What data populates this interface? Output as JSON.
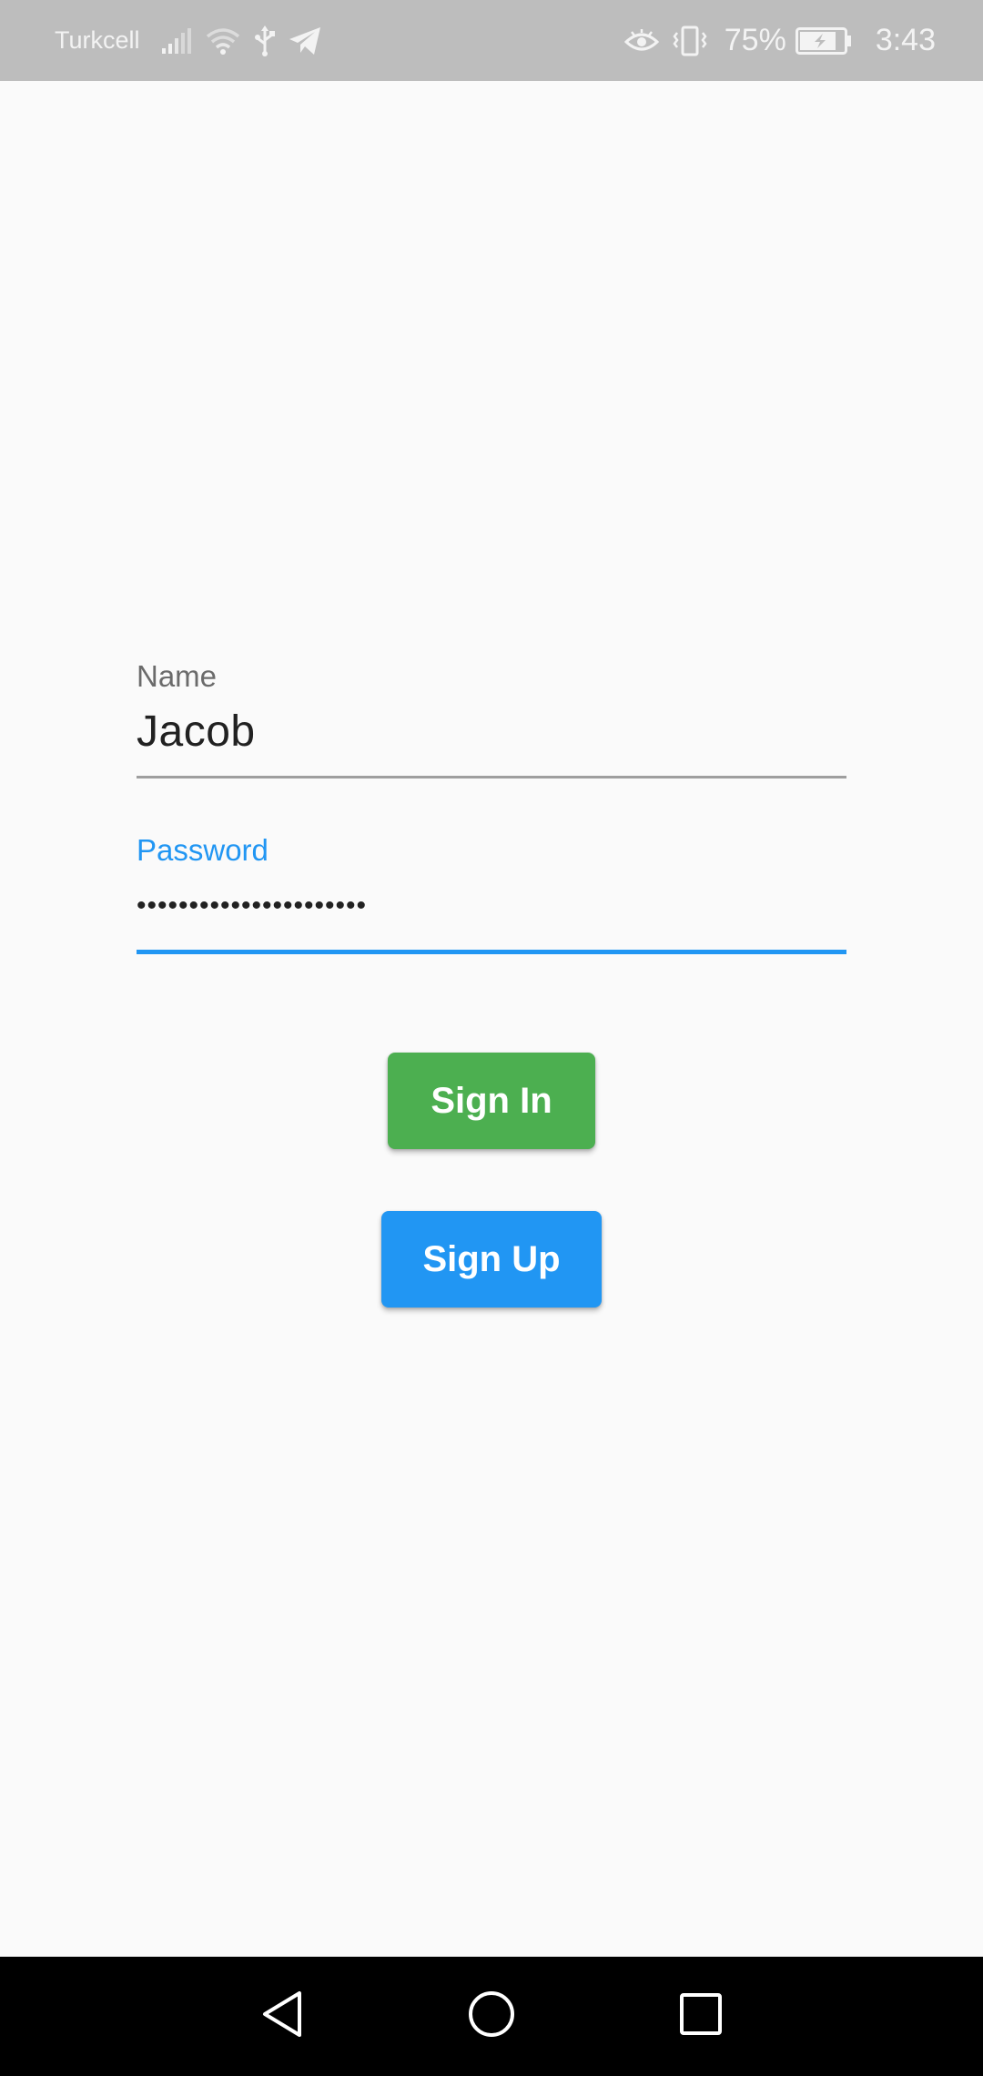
{
  "status_bar": {
    "carrier": "Turkcell",
    "battery_percent": "75%",
    "time": "3:43",
    "icons": [
      "signal-icon",
      "wifi-icon",
      "usb-icon",
      "telegram-icon",
      "eye-comfort-icon",
      "vibrate-icon",
      "battery-charging-icon"
    ]
  },
  "form": {
    "name_label": "Name",
    "name_value": "Jacob",
    "password_label": "Password",
    "password_masked": "••••••••••••••••••••••"
  },
  "buttons": {
    "sign_in": "Sign In",
    "sign_up": "Sign Up"
  },
  "colors": {
    "status_bar": "#bdbdbd",
    "background": "#fafafa",
    "accent": "#2196f3",
    "sign_in": "#4caf50",
    "sign_up": "#2196f3",
    "nav_bar": "#000000"
  },
  "nav_bar": {
    "buttons": [
      "back-icon",
      "home-icon",
      "recents-icon"
    ]
  }
}
